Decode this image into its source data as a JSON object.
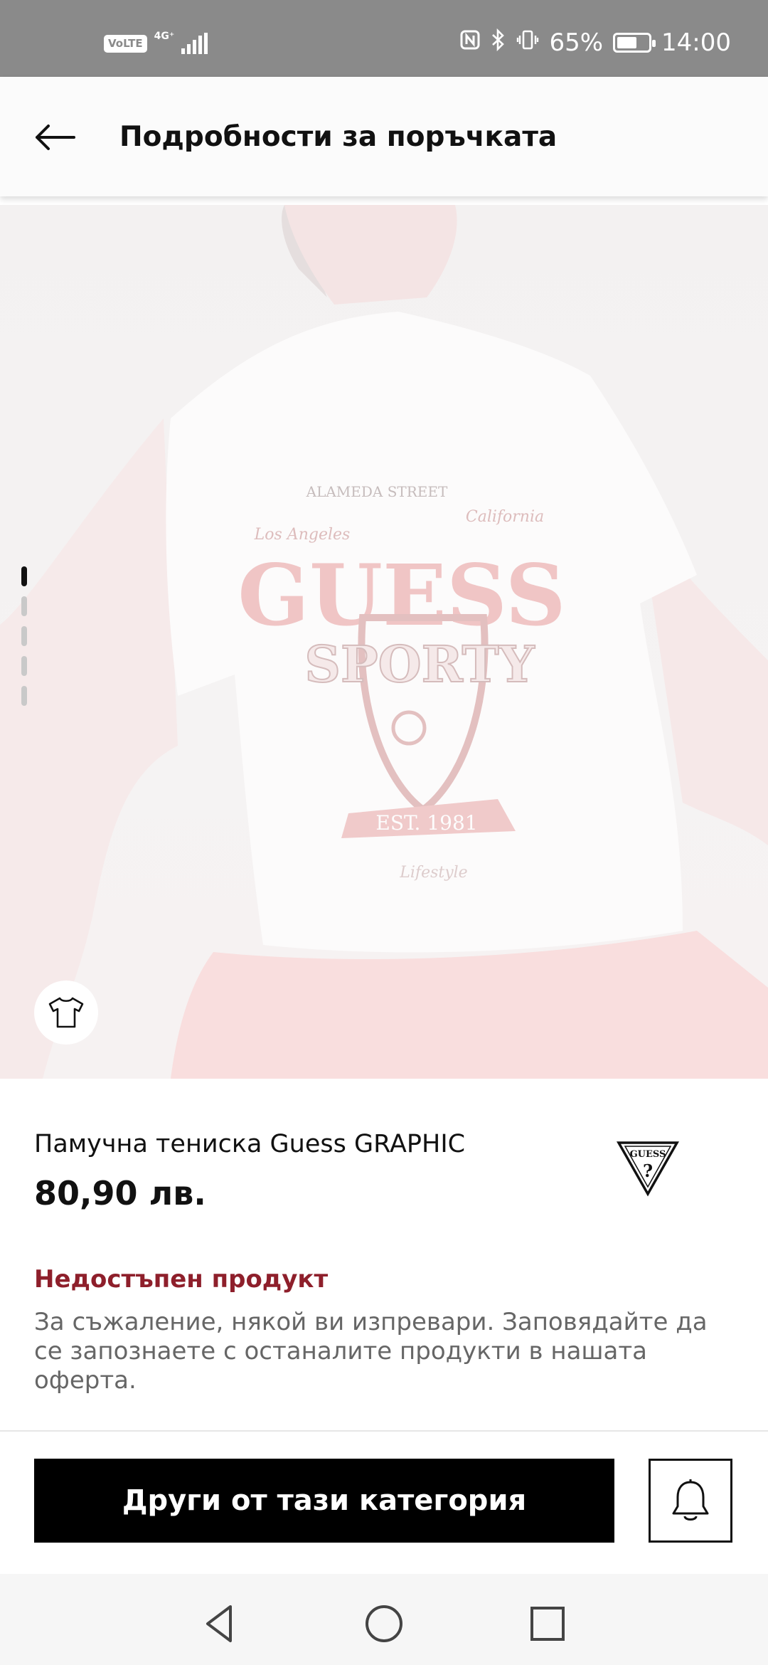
{
  "status_bar": {
    "volte": "VoLTE",
    "network": "4G⁺",
    "battery_percent": "65%",
    "battery_level": 0.65,
    "time": "14:00"
  },
  "header": {
    "title": "Подробности за поръчката",
    "back_icon": "arrow-left-icon"
  },
  "gallery": {
    "image_count": 5,
    "active_index": 0,
    "shirt_print": {
      "line1": "ALAMEDA STREET",
      "left_script": "Los Angeles",
      "right_script": "California",
      "brand": "GUESS",
      "arc_text": "SPORTY",
      "banner": "EST. 1981",
      "bottom_script": "Lifestyle"
    },
    "chip_icon": "tshirt-icon"
  },
  "product": {
    "name": "Памучна тениска Guess GRAPHIC",
    "price": "80,90 лв.",
    "brand_logo_text": "GUESS"
  },
  "availability": {
    "title": "Недостъпен продукт",
    "message": "За съжаление, някой ви изпревари. Заповядайте да се запознаете с останалите продукти в нашата оферта."
  },
  "actions": {
    "category_button": "Други от тази категория",
    "bell_icon": "bell-icon"
  },
  "nav": {
    "back_icon": "triangle-back-icon",
    "home_icon": "circle-home-icon",
    "recents_icon": "square-recents-icon"
  },
  "colors": {
    "status_bar": "#8a8a8a",
    "accent_red": "#8e1f2b",
    "text_primary": "#111111",
    "text_secondary": "#666666",
    "button_black": "#000000"
  }
}
